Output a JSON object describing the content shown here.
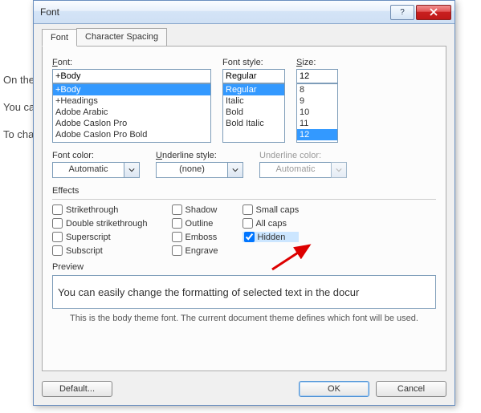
{
  "bg": {
    "p1": "On the                                                                                                                              the overall look of                                                                                                                  ers, lists, co pages,                                                                                                                           diagrams, th also c",
    "p2": "You ca                                                                                                                          osing a look or the                                                                                                                          format text directl                                                                                                                  of using th ook fr",
    "p3": "To cha                                                                                                                        e Page Layo ab. To                                                                                                                          ent Quick St Set cor                                                                                                                       commands hat yo                                                                                                                        n your curre empla"
  },
  "dialog": {
    "title": "Font",
    "tabs": {
      "font": "Font",
      "spacing": "Character Spacing"
    },
    "font": {
      "label": "Font:",
      "value": "+Body",
      "list": [
        "+Body",
        "+Headings",
        "Adobe Arabic",
        "Adobe Caslon Pro",
        "Adobe Caslon Pro Bold"
      ]
    },
    "style": {
      "label": "Font style:",
      "value": "Regular",
      "list": [
        "Regular",
        "Italic",
        "Bold",
        "Bold Italic"
      ]
    },
    "size": {
      "label": "Size:",
      "value": "12",
      "list": [
        "8",
        "9",
        "10",
        "11",
        "12"
      ]
    },
    "color": {
      "label": "Font color:",
      "value": "Automatic"
    },
    "underline": {
      "label": "Underline style:",
      "value": "(none)"
    },
    "ucolor": {
      "label": "Underline color:",
      "value": "Automatic"
    },
    "effects": {
      "label": "Effects",
      "strike": "Strikethrough",
      "dstrike": "Double strikethrough",
      "superscript": "Superscript",
      "subscript": "Subscript",
      "shadow": "Shadow",
      "outline": "Outline",
      "emboss": "Emboss",
      "engrave": "Engrave",
      "smallcaps": "Small caps",
      "allcaps": "All caps",
      "hidden": "Hidden"
    },
    "preview": {
      "label": "Preview",
      "text": "You can easily change the formatting of selected text in the docur",
      "note": "This is the body theme font. The current document theme defines which font will be used."
    },
    "buttons": {
      "default": "Default...",
      "ok": "OK",
      "cancel": "Cancel"
    }
  }
}
